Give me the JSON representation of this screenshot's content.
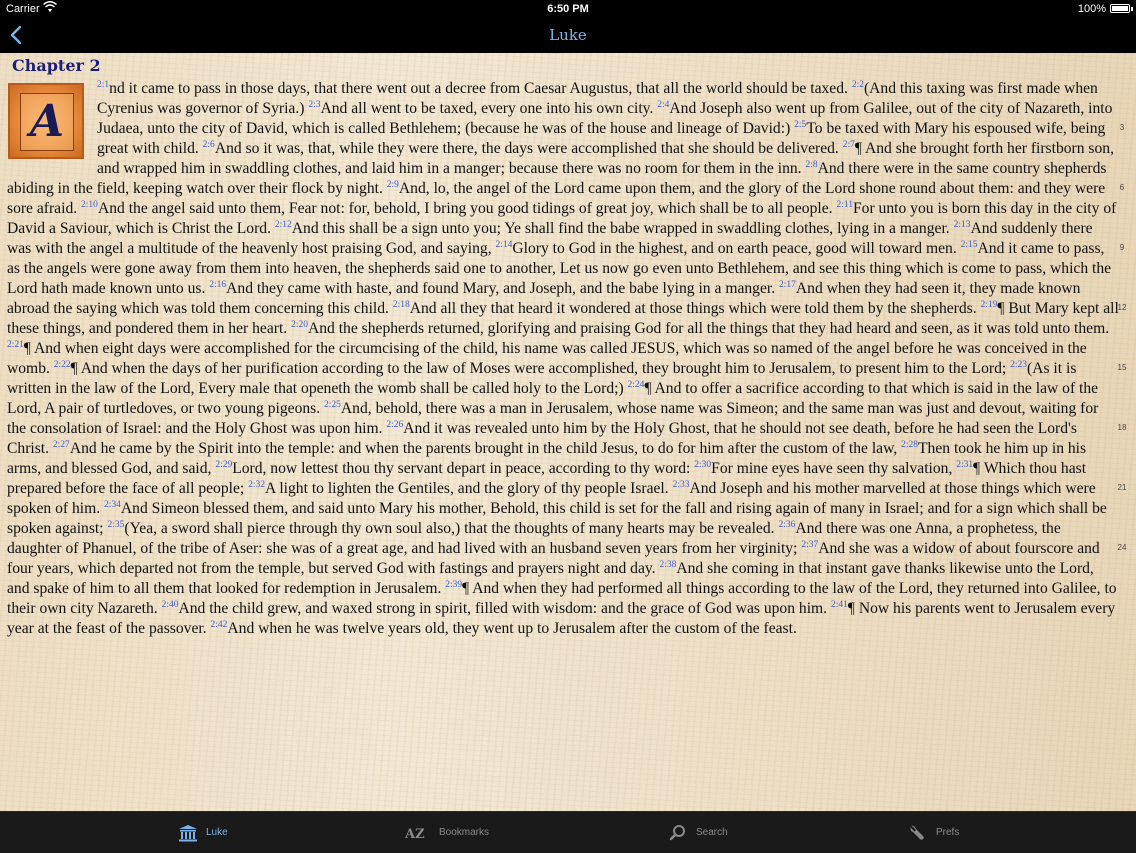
{
  "status_bar": {
    "carrier": "Carrier",
    "time": "6:50 PM",
    "battery_percent": "100%"
  },
  "nav": {
    "back_icon": "chevron-left-icon",
    "title": "Luke"
  },
  "chapter": {
    "heading": "Chapter 2",
    "dropcap_letter": "A",
    "margin_numbers": [
      "3",
      "6",
      "9",
      "12",
      "15",
      "18",
      "21",
      "24"
    ]
  },
  "verses": [
    {
      "ref": "2:1",
      "text": "nd it came to pass in those days, that there went out a decree from Caesar Augustus, that all the world should be taxed. "
    },
    {
      "ref": "2:2",
      "text": "(And this taxing was first made when Cyrenius was governor of Syria.) "
    },
    {
      "ref": "2:3",
      "text": "And all went to be taxed, every one into his own city. "
    },
    {
      "ref": "2:4",
      "text": "And Joseph also went up from Galilee, out of the city of Nazareth, into Judaea, unto the city of David, which is called Bethlehem; (because he was of the house and lineage of David:) "
    },
    {
      "ref": "2:5",
      "text": "To be taxed with Mary his espoused wife, being great with child. "
    },
    {
      "ref": "2:6",
      "text": "And so it was, that, while they were there, the days were accomplished that she should be delivered. "
    },
    {
      "ref": "2:7",
      "text": "¶ And she brought forth her firstborn son, and wrapped him in swaddling clothes, and laid him in a manger; because there was no room for them in the inn. "
    },
    {
      "ref": "2:8",
      "text": "And there were in the same country shepherds abiding in the field, keeping watch over their flock by night. "
    },
    {
      "ref": "2:9",
      "text": "And, lo, the angel of the Lord came upon them, and the glory of the Lord shone round about them: and they were sore afraid. "
    },
    {
      "ref": "2:10",
      "text": "And the angel said unto them, Fear not: for, behold, I bring you good tidings of great joy, which shall be to all people. "
    },
    {
      "ref": "2:11",
      "text": "For unto you is born this day in the city of David a Saviour, which is Christ the Lord. "
    },
    {
      "ref": "2:12",
      "text": "And this shall be a sign unto you; Ye shall find the babe wrapped in swaddling clothes, lying in a manger. "
    },
    {
      "ref": "2:13",
      "text": "And suddenly there was with the angel a multitude of the heavenly host praising God, and saying, "
    },
    {
      "ref": "2:14",
      "text": "Glory to God in the highest, and on earth peace, good will toward men. "
    },
    {
      "ref": "2:15",
      "text": "And it came to pass, as the angels were gone away from them into heaven, the shepherds said one to another, Let us now go even unto Bethlehem, and see this thing which is come to pass, which the Lord hath made known unto us. "
    },
    {
      "ref": "2:16",
      "text": "And they came with haste, and found Mary, and Joseph, and the babe lying in a manger. "
    },
    {
      "ref": "2:17",
      "text": "And when they had seen it, they made known abroad the saying which was told them concerning this child. "
    },
    {
      "ref": "2:18",
      "text": "And all they that heard it wondered at those things which were told them by the shepherds. "
    },
    {
      "ref": "2:19",
      "text": "¶ But Mary kept all these things, and pondered them in her heart. "
    },
    {
      "ref": "2:20",
      "text": "And the shepherds returned, glorifying and praising God for all the things that they had heard and seen, as it was told unto them. "
    },
    {
      "ref": "2:21",
      "text": "¶ And when eight days were accomplished for the circumcising of the child, his name was called JESUS, which was so named of the angel before he was conceived in the womb. "
    },
    {
      "ref": "2:22",
      "text": "¶ And when the days of her purification according to the law of Moses were accomplished, they brought him to Jerusalem, to present him to the Lord; "
    },
    {
      "ref": "2:23",
      "text": "(As it is written in the law of the Lord, Every male that openeth the womb shall be called holy to the Lord;) "
    },
    {
      "ref": "2:24",
      "text": "¶ And to offer a sacrifice according to that which is said in the law of the Lord, A pair of turtledoves, or two young pigeons. "
    },
    {
      "ref": "2:25",
      "text": "And, behold, there was a man in Jerusalem, whose name was Simeon; and the same man was just and devout, waiting for the consolation of Israel: and the Holy Ghost was upon him. "
    },
    {
      "ref": "2:26",
      "text": "And it was revealed unto him by the Holy Ghost, that he should not see death, before he had seen the Lord's Christ. "
    },
    {
      "ref": "2:27",
      "text": "And he came by the Spirit into the temple: and when the parents brought in the child Jesus, to do for him after the custom of the law, "
    },
    {
      "ref": "2:28",
      "text": "Then took he him up in his arms, and blessed God, and said, "
    },
    {
      "ref": "2:29",
      "text": "Lord, now lettest thou thy servant depart in peace, according to thy word: "
    },
    {
      "ref": "2:30",
      "text": "For mine eyes have seen thy salvation, "
    },
    {
      "ref": "2:31",
      "text": "¶ Which thou hast prepared before the face of all people; "
    },
    {
      "ref": "2:32",
      "text": "A light to lighten the Gentiles, and the glory of thy people Israel. "
    },
    {
      "ref": "2:33",
      "text": "And Joseph and his mother marvelled at those things which were spoken of him. "
    },
    {
      "ref": "2:34",
      "text": "And Simeon blessed them, and said unto Mary his mother, Behold, this child is set for the fall and rising again of many in Israel; and for a sign which shall be spoken against; "
    },
    {
      "ref": "2:35",
      "text": "(Yea, a sword shall pierce through thy own soul also,) that the thoughts of many hearts may be revealed. "
    },
    {
      "ref": "2:36",
      "text": "And there was one Anna, a prophetess, the daughter of Phanuel, of the tribe of Aser: she was of a great age, and had lived with an husband seven years from her virginity; "
    },
    {
      "ref": "2:37",
      "text": "And she was a widow of about fourscore and four years, which departed not from the temple, but served God with fastings and prayers night and day. "
    },
    {
      "ref": "2:38",
      "text": "And she coming in that instant gave thanks likewise unto the Lord, and spake of him to all them that looked for redemption in Jerusalem. "
    },
    {
      "ref": "2:39",
      "text": "¶ And when they had performed all things according to the law of the Lord, they returned into Galilee, to their own city Nazareth. "
    },
    {
      "ref": "2:40",
      "text": "And the child grew, and waxed strong in spirit, filled with wisdom: and the grace of God was upon him. "
    },
    {
      "ref": "2:41",
      "text": "¶ Now his parents went to Jerusalem every year at the feast of the passover. "
    },
    {
      "ref": "2:42",
      "text": "And when he was twelve years old, they went up to Jerusalem after the custom of the feast."
    }
  ],
  "tabs": [
    {
      "label": "Luke",
      "icon": "temple-icon",
      "active": true
    },
    {
      "label": "Bookmarks",
      "icon": "az-icon",
      "active": false
    },
    {
      "label": "Search",
      "icon": "magnifier-icon",
      "active": false
    },
    {
      "label": "Prefs",
      "icon": "wrench-icon",
      "active": false
    }
  ],
  "colors": {
    "accent": "#7db3e8",
    "chapter_heading": "#1c1f7a",
    "verse_ref": "#3b5bd6",
    "paper": "#f0e3ca"
  }
}
